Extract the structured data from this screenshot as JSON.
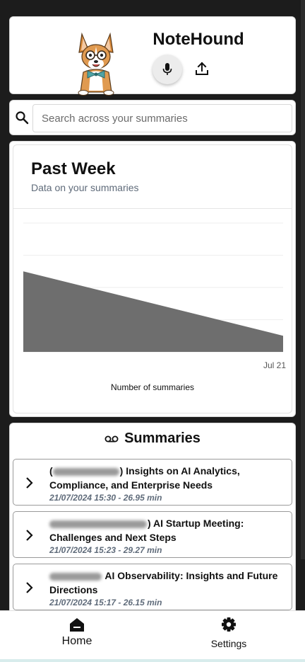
{
  "app": {
    "title": "NoteHound"
  },
  "search": {
    "placeholder": "Search across your summaries"
  },
  "chart_card": {
    "title": "Past Week",
    "subtitle": "Data on your summaries"
  },
  "chart_data": {
    "type": "area",
    "x": [
      "",
      "Jul 21"
    ],
    "tick_labels": [
      "Jul 21"
    ],
    "values": [
      5,
      1
    ],
    "xlabel": "Number of summaries",
    "ylabel": "",
    "ylim": [
      0,
      8
    ],
    "grid": true,
    "fill_color": "#6e6e6e"
  },
  "summaries": {
    "title": "Summaries",
    "items": [
      {
        "name": ") Insights on AI Analytics, Compliance, and Enterprise Needs",
        "name_prefix": "(",
        "meta": "21/07/2024 15:30 - 26.95 min"
      },
      {
        "name": ") AI Startup Meeting: Challenges and Next Steps",
        "name_prefix": "",
        "meta": "21/07/2024 15:23 - 29.27 min"
      },
      {
        "name": " AI Observability: Insights and Future Directions",
        "name_prefix": "",
        "meta": "21/07/2024 15:17 - 26.15 min"
      }
    ]
  },
  "nav": {
    "home": "Home",
    "settings": "Settings"
  },
  "colors": {
    "background": "#1c1c1c",
    "card": "#ffffff",
    "muted_text": "#5f6b7a",
    "chart_fill": "#6e6e6e"
  }
}
